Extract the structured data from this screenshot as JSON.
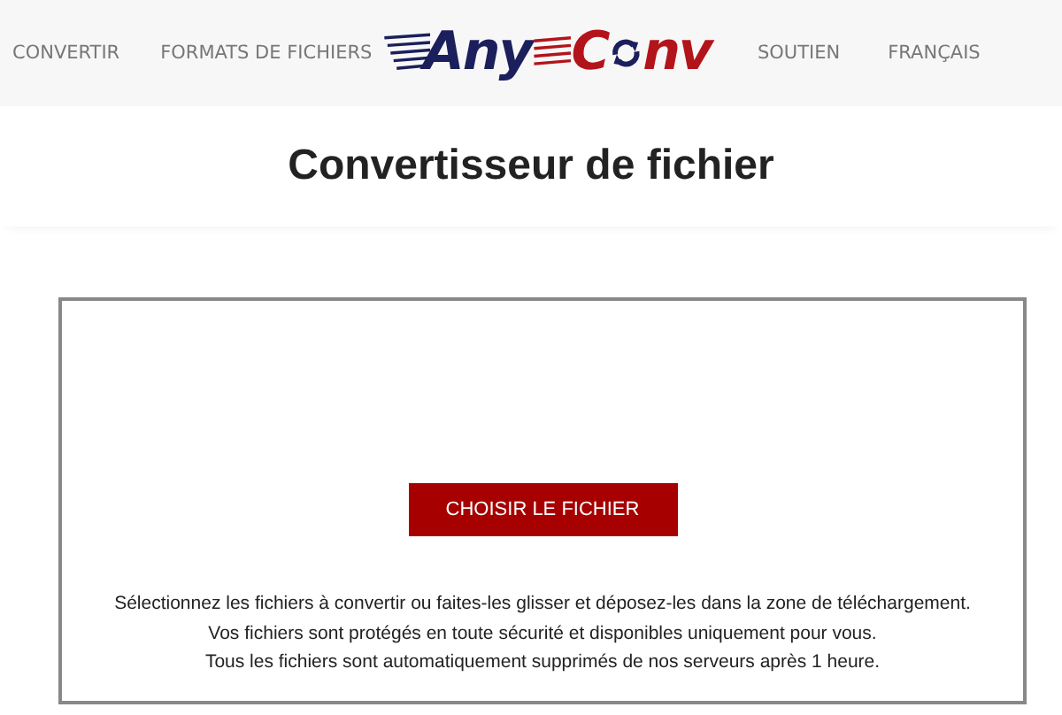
{
  "nav_left": [
    "CONVERTIR",
    "FORMATS DE FICHIERS"
  ],
  "logo": {
    "first": "Any",
    "second_start": "C",
    "second_end": "nv"
  },
  "nav_right": [
    "SOUTIEN",
    "FRANÇAIS"
  ],
  "title": "Convertisseur de fichier",
  "upload": {
    "button": "CHOISIR LE FICHIER",
    "notes": [
      "Sélectionnez les fichiers à convertir ou faites-les glisser et déposez-les dans la zone de téléchargement.",
      "Vos fichiers sont protégés en toute sécurité et disponibles uniquement pour vous.",
      "Tous les fichiers sont automatiquement supprimés de nos serveurs après 1 heure."
    ]
  }
}
